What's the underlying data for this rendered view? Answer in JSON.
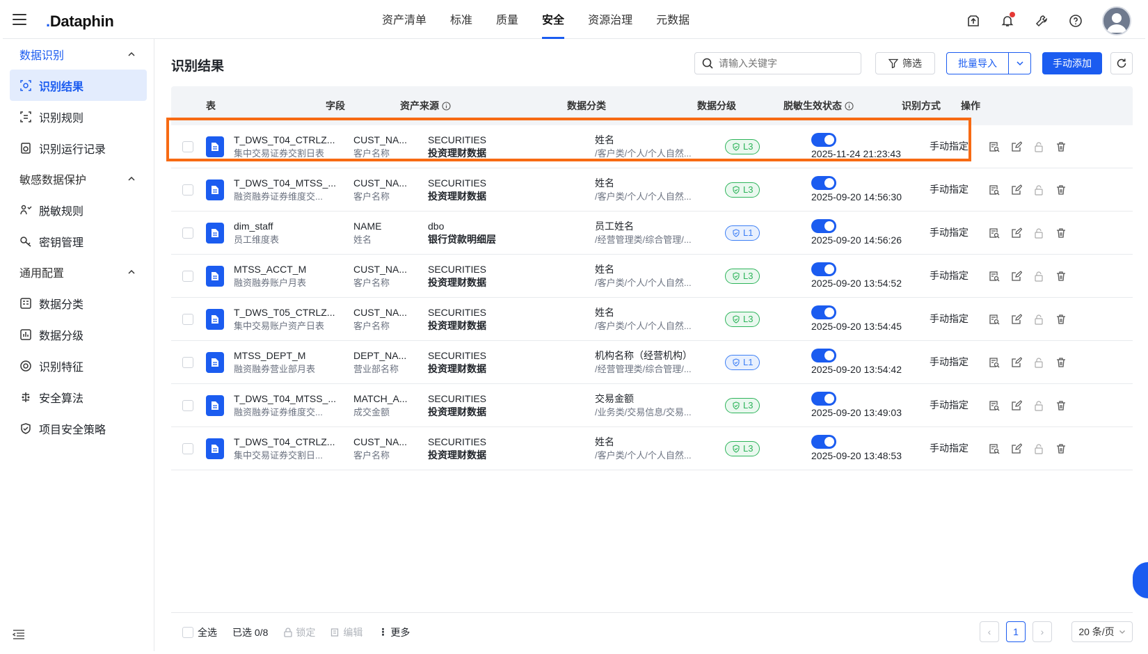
{
  "topbar": {
    "logo": "Dataphin",
    "nav": [
      "资产清单",
      "标准",
      "质量",
      "安全",
      "资源治理",
      "元数据"
    ],
    "active_nav": "安全",
    "icons": [
      "upload-icon",
      "bell-icon",
      "wrench-icon",
      "help-icon",
      "user-avatar"
    ]
  },
  "sidebar": {
    "groups": [
      {
        "title": "数据识别",
        "items": [
          "识别结果",
          "识别规则",
          "识别运行记录"
        ]
      },
      {
        "title": "敏感数据保护",
        "items": [
          "脱敏规则",
          "密钥管理"
        ]
      },
      {
        "title": "通用配置",
        "items": [
          "数据分类",
          "数据分级",
          "识别特征",
          "安全算法",
          "项目安全策略"
        ]
      }
    ],
    "active_item": "识别结果"
  },
  "main": {
    "title": "识别结果",
    "search_placeholder": "请输入关键字",
    "filter_label": "筛选",
    "import_label": "批量导入",
    "add_label": "手动添加"
  },
  "table": {
    "headers": [
      "表",
      "字段",
      "资产来源",
      "数据分类",
      "数据分级",
      "脱敏生效状态",
      "识别方式",
      "操作"
    ],
    "rows": [
      {
        "table_name": "T_DWS_T04_CTRLZ...",
        "table_desc": "集中交易证券交割日表",
        "field": "CUST_NA...",
        "field_desc": "客户名称",
        "src": "SECURITIES",
        "src_desc": "投资理财数据",
        "cls": "姓名",
        "cls_path": "/客户类/个人/个人自然...",
        "level": "L3",
        "mask_time": "2025-11-24 21:23:43",
        "mode": "手动指定"
      },
      {
        "table_name": "T_DWS_T04_MTSS_...",
        "table_desc": "融资融券证券维度交...",
        "field": "CUST_NA...",
        "field_desc": "客户名称",
        "src": "SECURITIES",
        "src_desc": "投资理财数据",
        "cls": "姓名",
        "cls_path": "/客户类/个人/个人自然...",
        "level": "L3",
        "mask_time": "2025-09-20 14:56:30",
        "mode": "手动指定"
      },
      {
        "table_name": "dim_staff",
        "table_desc": "员工维度表",
        "field": "NAME",
        "field_desc": "姓名",
        "src": "dbo",
        "src_desc": "银行贷款明细层",
        "cls": "员工姓名",
        "cls_path": "/经营管理类/综合管理/...",
        "level": "L1",
        "mask_time": "2025-09-20 14:56:26",
        "mode": "手动指定"
      },
      {
        "table_name": "MTSS_ACCT_M",
        "table_desc": "融资融券账户月表",
        "field": "CUST_NA...",
        "field_desc": "客户名称",
        "src": "SECURITIES",
        "src_desc": "投资理财数据",
        "cls": "姓名",
        "cls_path": "/客户类/个人/个人自然...",
        "level": "L3",
        "mask_time": "2025-09-20 13:54:52",
        "mode": "手动指定"
      },
      {
        "table_name": "T_DWS_T05_CTRLZ...",
        "table_desc": "集中交易账户资产日表",
        "field": "CUST_NA...",
        "field_desc": "客户名称",
        "src": "SECURITIES",
        "src_desc": "投资理财数据",
        "cls": "姓名",
        "cls_path": "/客户类/个人/个人自然...",
        "level": "L3",
        "mask_time": "2025-09-20 13:54:45",
        "mode": "手动指定"
      },
      {
        "table_name": "MTSS_DEPT_M",
        "table_desc": "融资融券营业部月表",
        "field": "DEPT_NA...",
        "field_desc": "营业部名称",
        "src": "SECURITIES",
        "src_desc": "投资理财数据",
        "cls": "机构名称（经营机构）",
        "cls_path": "/经营管理类/综合管理/...",
        "level": "L1",
        "mask_time": "2025-09-20 13:54:42",
        "mode": "手动指定"
      },
      {
        "table_name": "T_DWS_T04_MTSS_...",
        "table_desc": "融资融券证券维度交...",
        "field": "MATCH_A...",
        "field_desc": "成交金额",
        "src": "SECURITIES",
        "src_desc": "投资理财数据",
        "cls": "交易金额",
        "cls_path": "/业务类/交易信息/交易...",
        "level": "L3",
        "mask_time": "2025-09-20 13:49:03",
        "mode": "手动指定"
      },
      {
        "table_name": "T_DWS_T04_CTRLZ...",
        "table_desc": "集中交易证券交割日...",
        "field": "CUST_NA...",
        "field_desc": "客户名称",
        "src": "SECURITIES",
        "src_desc": "投资理财数据",
        "cls": "姓名",
        "cls_path": "/客户类/个人/个人自然...",
        "level": "L3",
        "mask_time": "2025-09-20 13:48:53",
        "mode": "手动指定"
      }
    ]
  },
  "footer": {
    "select_all": "全选",
    "selected": "已选 0/8",
    "lock": "锁定",
    "edit": "编辑",
    "more": "更多",
    "page": "1",
    "page_size": "20 条/页"
  },
  "colors": {
    "accent": "#1b5cf0",
    "highlight": "#f76a13",
    "l3": "#2db45a",
    "l1": "#3d7ff5"
  }
}
